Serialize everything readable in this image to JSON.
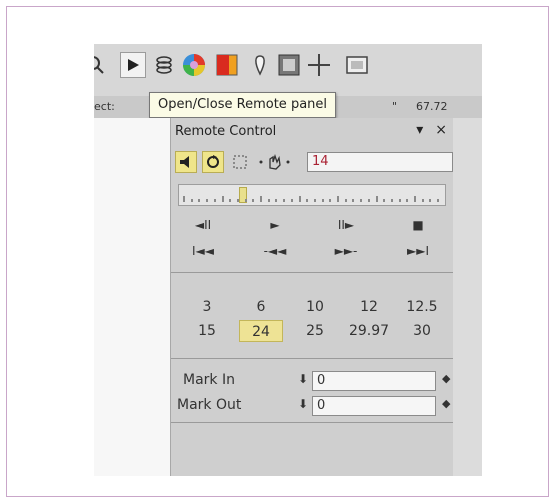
{
  "tooltip": "Open/Close Remote panel",
  "status": {
    "left": "ect:",
    "mid": "\"",
    "right": "67.72"
  },
  "toolbar": {
    "icons": [
      "magnify-icon",
      "play-icon",
      "layers-icon",
      "color-wheel-icon",
      "color-swatch-icon",
      "marker-icon",
      "screen-icon",
      "crosshair-icon",
      "film-icon"
    ]
  },
  "panel": {
    "title": "Remote Control",
    "menu_glyph": "▾",
    "close_glyph": "×",
    "frame_value": "14",
    "transport_row1": [
      "◄II",
      "►",
      "II►",
      "■"
    ],
    "transport_row2": [
      "I◄◄",
      "-◄◄",
      "►►-",
      "►►I"
    ],
    "fps_rows": [
      [
        "3",
        "6",
        "10",
        "12",
        "12.5"
      ],
      [
        "15",
        "24",
        "25",
        "29.97",
        "30"
      ]
    ],
    "fps_selected": "24",
    "mark_in_label": "Mark In",
    "mark_out_label": "Mark Out",
    "mark_in_value": "0",
    "mark_out_value": "0",
    "playhead_fraction": 0.24
  },
  "colors": {
    "highlight": "#eee395",
    "panel": "#cfcfcf",
    "border": "#c9a6c9"
  }
}
